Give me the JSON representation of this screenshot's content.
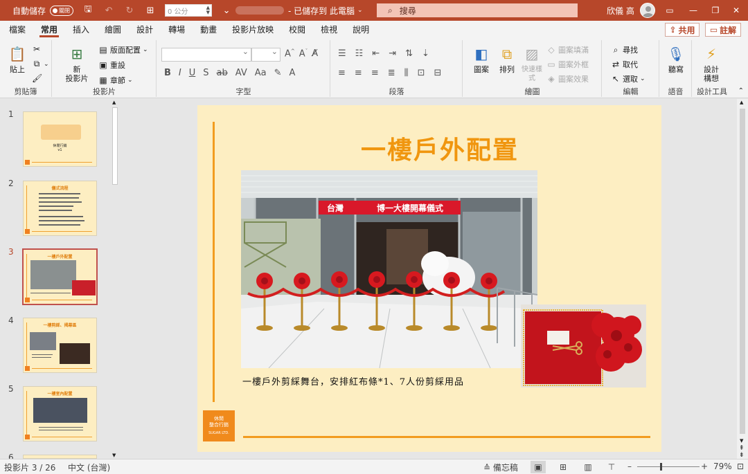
{
  "titlebar": {
    "autosave_label": "自動儲存",
    "autosave_state": "關閉",
    "unit_value": "0 公分",
    "doc_title": "- 已儲存到 此電腦",
    "search_placeholder": "搜尋",
    "user_name": "欣儀 高",
    "accent_color": "#b7472a"
  },
  "menu": {
    "tabs": [
      "檔案",
      "常用",
      "插入",
      "繪圖",
      "設計",
      "轉場",
      "動畫",
      "投影片放映",
      "校閱",
      "檢視",
      "說明"
    ],
    "active_tab": "常用",
    "share_label": "共用",
    "comment_label": "註解"
  },
  "ribbon": {
    "clipboard": {
      "paste": "貼上",
      "label": "剪貼簿"
    },
    "slides": {
      "new_slide": "新\n投影片",
      "layout": "版面配置",
      "reset": "重設",
      "section": "章節",
      "label": "投影片"
    },
    "font": {
      "label": "字型"
    },
    "paragraph": {
      "label": "段落"
    },
    "drawing": {
      "shapes": "圖案",
      "arrange": "排列",
      "quick_styles": "快速樣式",
      "fill": "圖案填滿",
      "outline": "圖案外框",
      "effects": "圖案效果",
      "label": "繪圖"
    },
    "editing": {
      "find": "尋找",
      "replace": "取代",
      "select": "選取",
      "label": "編輯"
    },
    "voice": {
      "dictate": "聽寫",
      "label": "語音"
    },
    "designer": {
      "ideas": "設計\n構想",
      "label": "設計工具"
    }
  },
  "thumbnails": [
    {
      "num": "1",
      "title": "",
      "subtitle": "休閒行銷\nv1"
    },
    {
      "num": "2",
      "title": "儀式流程"
    },
    {
      "num": "3",
      "title": "一樓戶外配置",
      "active": true
    },
    {
      "num": "4",
      "title": "一樓剪綵、揭幕區"
    },
    {
      "num": "5",
      "title": "一樓室內配置"
    },
    {
      "num": "6",
      "title": ""
    }
  ],
  "slide": {
    "title": "一樓戶外配置",
    "banner": "台灣　　　　博一大樓開幕儀式",
    "caption": "一樓戶外剪綵舞台，安排紅布條*1、7人份剪綵用品",
    "logo_line1": "休閒",
    "logo_line2": "整合行銷",
    "logo_line3": "SUGAR LTD.",
    "accent_color": "#f29c1f",
    "title_color": "#f0960f"
  },
  "status": {
    "slide_info": "投影片 3 / 26",
    "language": "中文 (台灣)",
    "notes": "備忘稿",
    "zoom": "79%"
  }
}
